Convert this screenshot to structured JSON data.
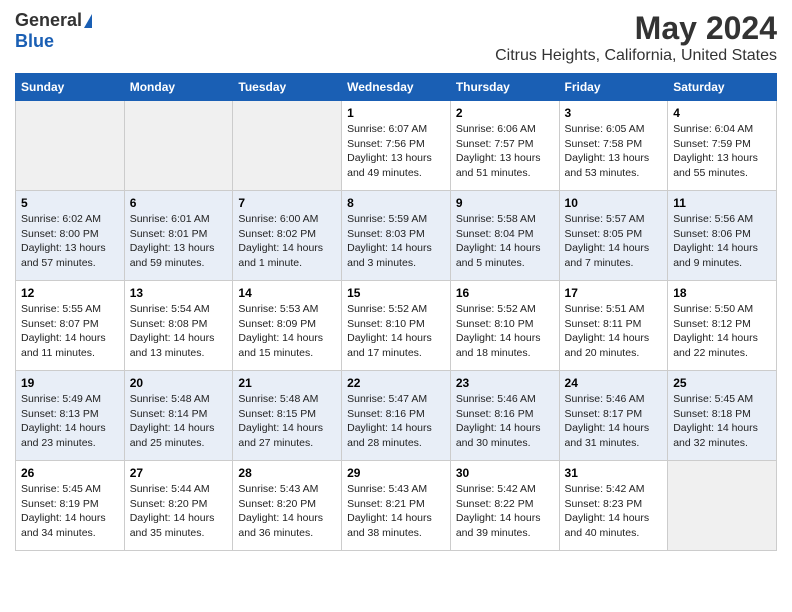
{
  "logo": {
    "general": "General",
    "blue": "Blue"
  },
  "title": "May 2024",
  "subtitle": "Citrus Heights, California, United States",
  "days_of_week": [
    "Sunday",
    "Monday",
    "Tuesday",
    "Wednesday",
    "Thursday",
    "Friday",
    "Saturday"
  ],
  "weeks": [
    {
      "id": "week1",
      "cells": [
        {
          "day": "",
          "content": ""
        },
        {
          "day": "",
          "content": ""
        },
        {
          "day": "",
          "content": ""
        },
        {
          "day": "1",
          "content": "Sunrise: 6:07 AM\nSunset: 7:56 PM\nDaylight: 13 hours\nand 49 minutes."
        },
        {
          "day": "2",
          "content": "Sunrise: 6:06 AM\nSunset: 7:57 PM\nDaylight: 13 hours\nand 51 minutes."
        },
        {
          "day": "3",
          "content": "Sunrise: 6:05 AM\nSunset: 7:58 PM\nDaylight: 13 hours\nand 53 minutes."
        },
        {
          "day": "4",
          "content": "Sunrise: 6:04 AM\nSunset: 7:59 PM\nDaylight: 13 hours\nand 55 minutes."
        }
      ]
    },
    {
      "id": "week2",
      "cells": [
        {
          "day": "5",
          "content": "Sunrise: 6:02 AM\nSunset: 8:00 PM\nDaylight: 13 hours\nand 57 minutes."
        },
        {
          "day": "6",
          "content": "Sunrise: 6:01 AM\nSunset: 8:01 PM\nDaylight: 13 hours\nand 59 minutes."
        },
        {
          "day": "7",
          "content": "Sunrise: 6:00 AM\nSunset: 8:02 PM\nDaylight: 14 hours\nand 1 minute."
        },
        {
          "day": "8",
          "content": "Sunrise: 5:59 AM\nSunset: 8:03 PM\nDaylight: 14 hours\nand 3 minutes."
        },
        {
          "day": "9",
          "content": "Sunrise: 5:58 AM\nSunset: 8:04 PM\nDaylight: 14 hours\nand 5 minutes."
        },
        {
          "day": "10",
          "content": "Sunrise: 5:57 AM\nSunset: 8:05 PM\nDaylight: 14 hours\nand 7 minutes."
        },
        {
          "day": "11",
          "content": "Sunrise: 5:56 AM\nSunset: 8:06 PM\nDaylight: 14 hours\nand 9 minutes."
        }
      ]
    },
    {
      "id": "week3",
      "cells": [
        {
          "day": "12",
          "content": "Sunrise: 5:55 AM\nSunset: 8:07 PM\nDaylight: 14 hours\nand 11 minutes."
        },
        {
          "day": "13",
          "content": "Sunrise: 5:54 AM\nSunset: 8:08 PM\nDaylight: 14 hours\nand 13 minutes."
        },
        {
          "day": "14",
          "content": "Sunrise: 5:53 AM\nSunset: 8:09 PM\nDaylight: 14 hours\nand 15 minutes."
        },
        {
          "day": "15",
          "content": "Sunrise: 5:52 AM\nSunset: 8:10 PM\nDaylight: 14 hours\nand 17 minutes."
        },
        {
          "day": "16",
          "content": "Sunrise: 5:52 AM\nSunset: 8:10 PM\nDaylight: 14 hours\nand 18 minutes."
        },
        {
          "day": "17",
          "content": "Sunrise: 5:51 AM\nSunset: 8:11 PM\nDaylight: 14 hours\nand 20 minutes."
        },
        {
          "day": "18",
          "content": "Sunrise: 5:50 AM\nSunset: 8:12 PM\nDaylight: 14 hours\nand 22 minutes."
        }
      ]
    },
    {
      "id": "week4",
      "cells": [
        {
          "day": "19",
          "content": "Sunrise: 5:49 AM\nSunset: 8:13 PM\nDaylight: 14 hours\nand 23 minutes."
        },
        {
          "day": "20",
          "content": "Sunrise: 5:48 AM\nSunset: 8:14 PM\nDaylight: 14 hours\nand 25 minutes."
        },
        {
          "day": "21",
          "content": "Sunrise: 5:48 AM\nSunset: 8:15 PM\nDaylight: 14 hours\nand 27 minutes."
        },
        {
          "day": "22",
          "content": "Sunrise: 5:47 AM\nSunset: 8:16 PM\nDaylight: 14 hours\nand 28 minutes."
        },
        {
          "day": "23",
          "content": "Sunrise: 5:46 AM\nSunset: 8:16 PM\nDaylight: 14 hours\nand 30 minutes."
        },
        {
          "day": "24",
          "content": "Sunrise: 5:46 AM\nSunset: 8:17 PM\nDaylight: 14 hours\nand 31 minutes."
        },
        {
          "day": "25",
          "content": "Sunrise: 5:45 AM\nSunset: 8:18 PM\nDaylight: 14 hours\nand 32 minutes."
        }
      ]
    },
    {
      "id": "week5",
      "cells": [
        {
          "day": "26",
          "content": "Sunrise: 5:45 AM\nSunset: 8:19 PM\nDaylight: 14 hours\nand 34 minutes."
        },
        {
          "day": "27",
          "content": "Sunrise: 5:44 AM\nSunset: 8:20 PM\nDaylight: 14 hours\nand 35 minutes."
        },
        {
          "day": "28",
          "content": "Sunrise: 5:43 AM\nSunset: 8:20 PM\nDaylight: 14 hours\nand 36 minutes."
        },
        {
          "day": "29",
          "content": "Sunrise: 5:43 AM\nSunset: 8:21 PM\nDaylight: 14 hours\nand 38 minutes."
        },
        {
          "day": "30",
          "content": "Sunrise: 5:42 AM\nSunset: 8:22 PM\nDaylight: 14 hours\nand 39 minutes."
        },
        {
          "day": "31",
          "content": "Sunrise: 5:42 AM\nSunset: 8:23 PM\nDaylight: 14 hours\nand 40 minutes."
        },
        {
          "day": "",
          "content": ""
        }
      ]
    }
  ]
}
